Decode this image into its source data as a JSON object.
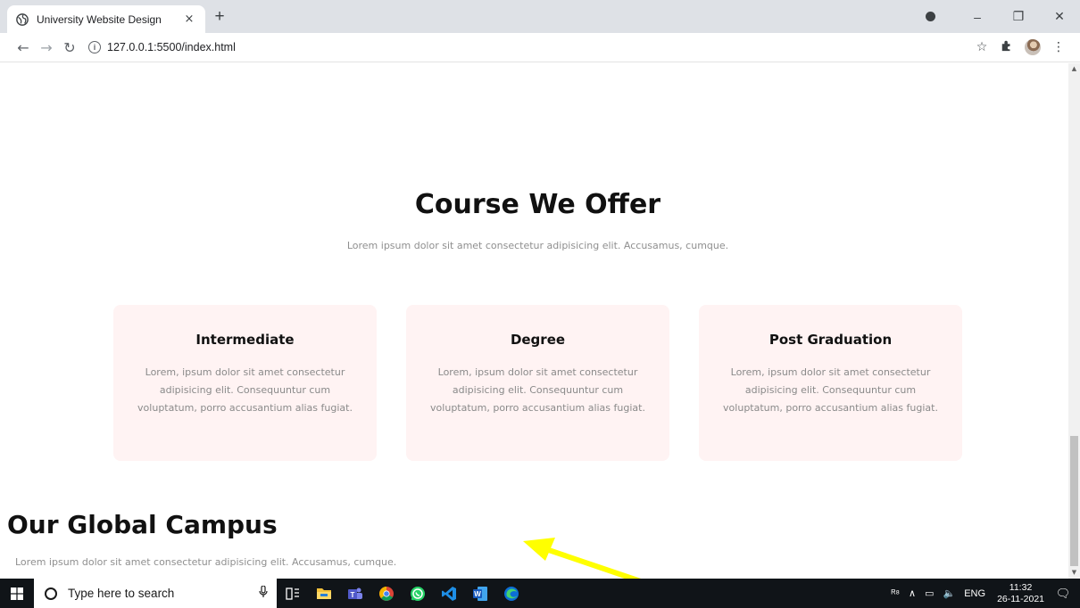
{
  "browser": {
    "tab_title": "University Website Design",
    "tab_close": "×",
    "new_tab": "+",
    "url": "127.0.0.1:5500/index.html",
    "window_minimize": "–",
    "window_restore": "❐",
    "window_close": "✕"
  },
  "page": {
    "course_title": "Course We Offer",
    "course_subtitle": "Lorem ipsum dolor sit amet consectetur adipisicing elit. Accusamus, cumque.",
    "cards": [
      {
        "title": "Intermediate",
        "body": "Lorem, ipsum dolor sit amet consectetur adipisicing elit. Consequuntur cum voluptatum, porro accusantium alias fugiat."
      },
      {
        "title": "Degree",
        "body": "Lorem, ipsum dolor sit amet consectetur adipisicing elit. Consequuntur cum voluptatum, porro accusantium alias fugiat."
      },
      {
        "title": "Post Graduation",
        "body": "Lorem, ipsum dolor sit amet consectetur adipisicing elit. Consequuntur cum voluptatum, porro accusantium alias fugiat."
      }
    ],
    "campus_title": "Our Global Campus",
    "campus_subtitle": "Lorem ipsum dolor sit amet consectetur adipisicing elit. Accusamus, cumque."
  },
  "taskbar": {
    "search_placeholder": "Type here to search",
    "language": "ENG",
    "time": "11:32",
    "date": "26-11-2021"
  },
  "colors": {
    "card_bg": "#fff3f3",
    "annotation_arrow": "#ffff00",
    "taskbar": "#101418"
  },
  "icons": [
    "globe-icon",
    "info-icon",
    "star-icon",
    "extensions-icon",
    "windows-start-icon",
    "search-icon",
    "microphone-icon",
    "task-view-icon",
    "file-explorer-icon",
    "teams-icon",
    "chrome-icon",
    "whatsapp-icon",
    "vscode-icon",
    "word-icon",
    "edge-icon"
  ]
}
